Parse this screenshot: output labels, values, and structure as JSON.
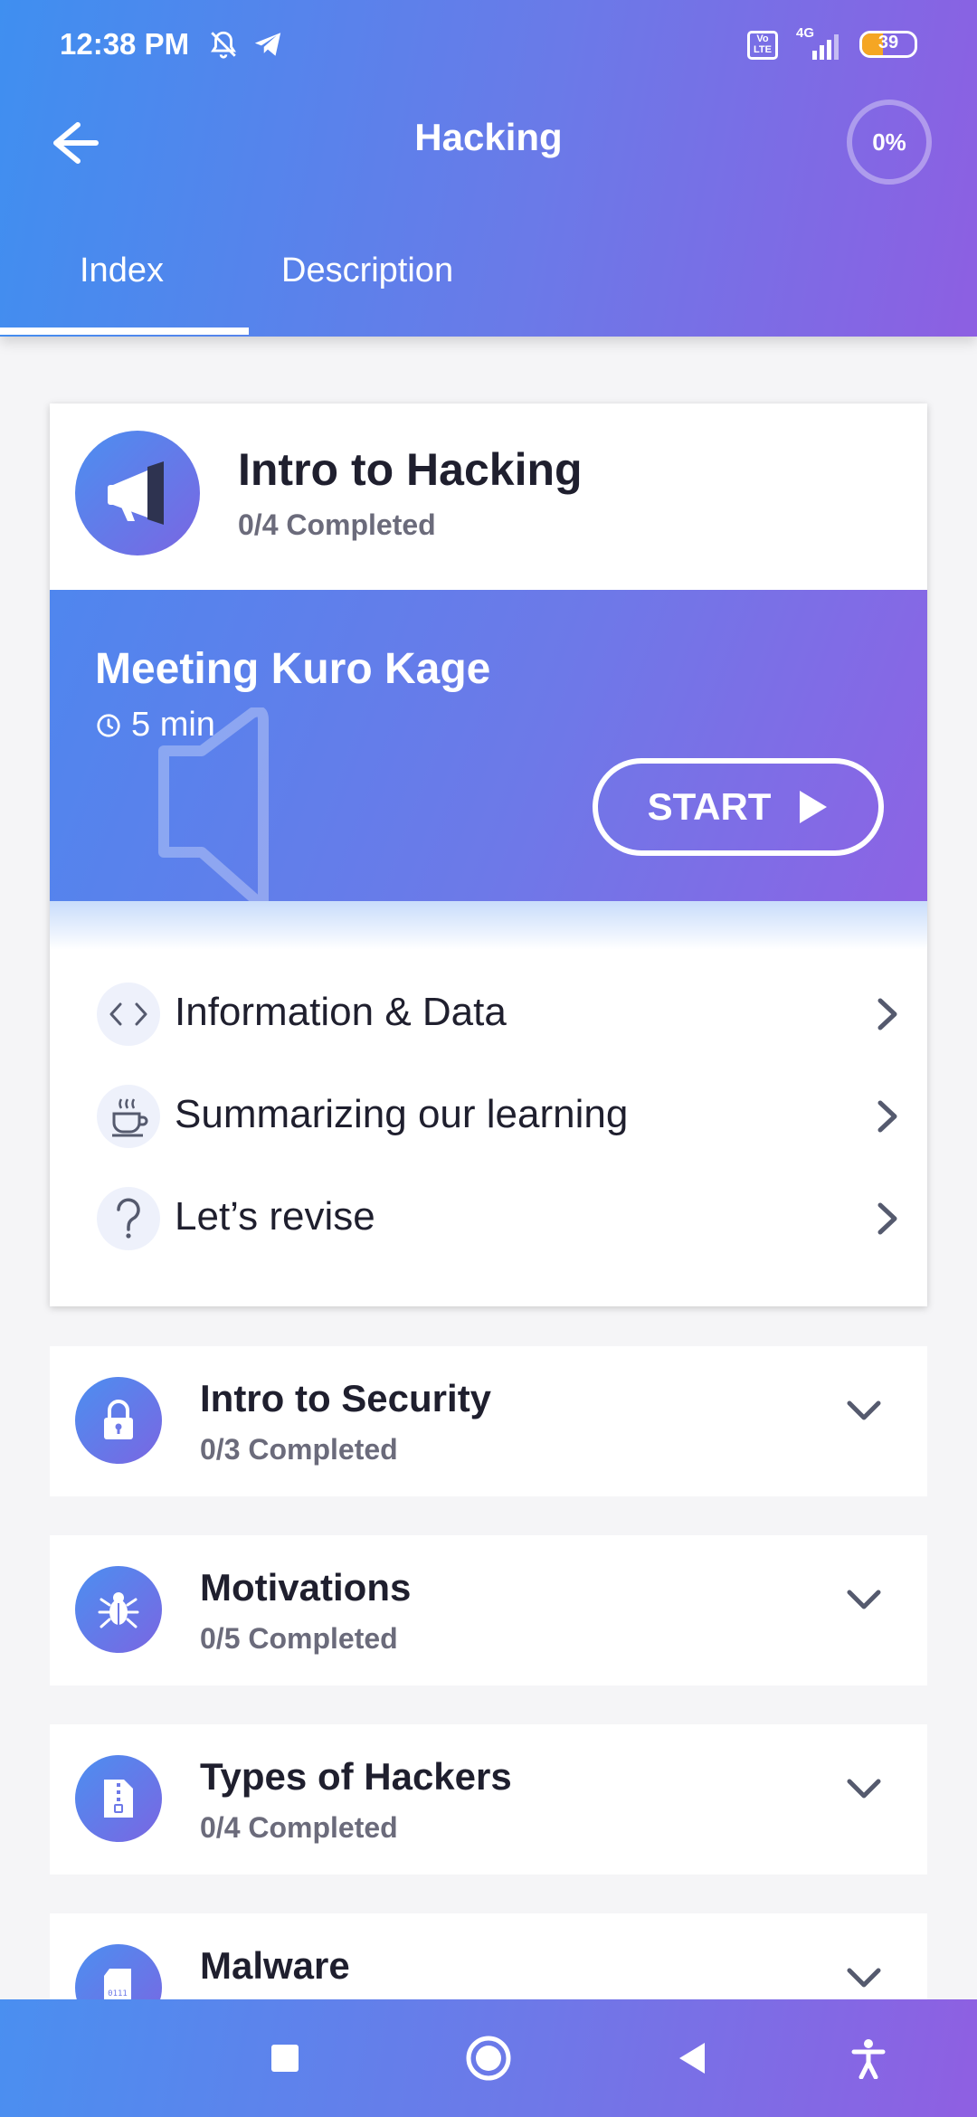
{
  "status_bar": {
    "time": "12:38 PM",
    "battery": "39",
    "battery_level": 0.39,
    "network": "4G",
    "icons": [
      "mute-bell-icon",
      "telegram-icon",
      "volte-icon",
      "signal-icon",
      "battery-icon"
    ]
  },
  "header": {
    "title": "Hacking",
    "progress": "0%"
  },
  "tabs": [
    {
      "label": "Index",
      "active": true
    },
    {
      "label": "Description",
      "active": false
    }
  ],
  "module": {
    "title": "Intro to Hacking",
    "subtitle": "0/4 Completed",
    "icon": "megaphone-icon",
    "lesson": {
      "title": "Meeting Kuro Kage",
      "duration": "5 min",
      "start_label": "START"
    },
    "items": [
      {
        "label": "Information & Data",
        "icon": "code-brackets-icon"
      },
      {
        "label": "Summarizing our learning",
        "icon": "coffee-cup-icon"
      },
      {
        "label": "Let’s revise",
        "icon": "question-icon"
      }
    ]
  },
  "sections": [
    {
      "title": "Intro to Security",
      "subtitle": "0/3 Completed",
      "icon": "lock-icon"
    },
    {
      "title": "Motivations",
      "subtitle": "0/5 Completed",
      "icon": "bug-icon"
    },
    {
      "title": "Types of Hackers",
      "subtitle": "0/4 Completed",
      "icon": "zip-file-icon"
    },
    {
      "title": "Malware",
      "subtitle": "",
      "icon": "sd-card-icon"
    }
  ],
  "colors": {
    "gradient_start": "#3f8ff0",
    "gradient_end": "#8d5fe2",
    "text_dark": "#1f1f2e",
    "text_muted": "#6b6b7b"
  }
}
